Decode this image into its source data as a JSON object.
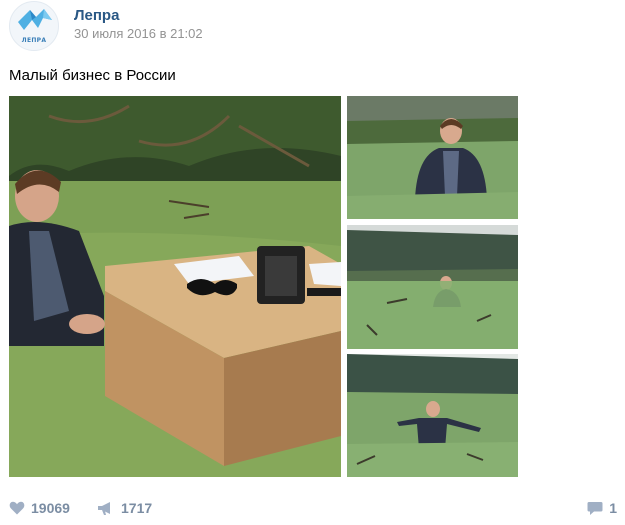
{
  "post": {
    "author": "Лепра",
    "date": "30 июля 2016 в 21:02",
    "avatar_label": "ЛЕПРА",
    "text": "Малый бизнес в России"
  },
  "photos": [
    {
      "name": "photo-boy-desk-swamp"
    },
    {
      "name": "photo-boy-in-swamp-1"
    },
    {
      "name": "photo-boy-in-swamp-2"
    },
    {
      "name": "photo-boy-in-swamp-3"
    }
  ],
  "actions": {
    "likes": "19069",
    "shares": "1717",
    "comments": "1"
  },
  "icons": {
    "like": "heart-icon",
    "share": "megaphone-icon",
    "comment": "comment-icon"
  },
  "colors": {
    "author": "#2a5885",
    "date": "#939393",
    "action": "#7b8da3"
  }
}
